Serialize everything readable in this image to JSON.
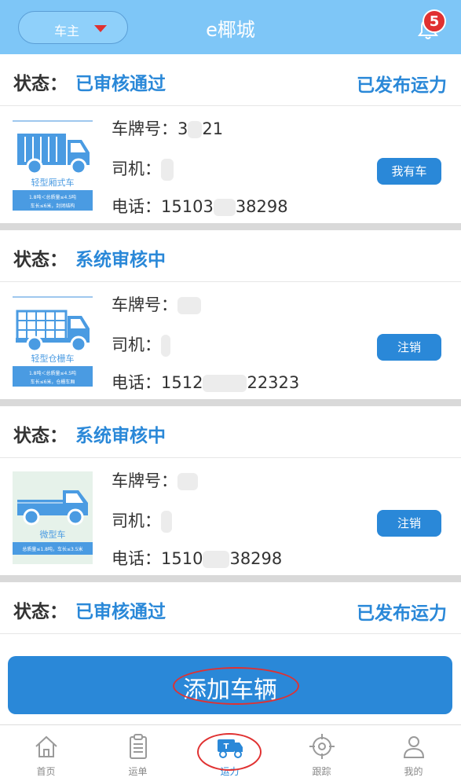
{
  "header": {
    "role": "车主",
    "title": "e椰城",
    "notification_count": "5"
  },
  "cards": [
    {
      "status_label": "状态：",
      "status": "已审核通过",
      "header_action": "已发布运力",
      "vehicle_type": "轻型厢式车",
      "vehicle_spec_1": "1.8吨＜总质量≤4.5吨",
      "vehicle_spec_2": "车长≤6米，封闭结构",
      "plate_label": "车牌号：",
      "plate_value": "3",
      "plate_suffix": "21",
      "driver_label": "司机：",
      "phone_label": "电话：",
      "phone_prefix": "15103",
      "phone_suffix": "38298",
      "button": "我有车"
    },
    {
      "status_label": "状态：",
      "status": "系统审核中",
      "vehicle_type": "轻型仓栅车",
      "vehicle_spec_1": "1.8吨＜总质量≤4.5吨",
      "vehicle_spec_2": "车长≤6米，仓栅车厢",
      "plate_label": "车牌号：",
      "driver_label": "司机：",
      "phone_label": "电话：",
      "phone_prefix": "1512",
      "phone_suffix": "22323",
      "button": "注销"
    },
    {
      "status_label": "状态：",
      "status": "系统审核中",
      "vehicle_type": "微型车",
      "vehicle_spec_1": "总质量≤1.8吨，车长≤3.5米",
      "plate_label": "车牌号：",
      "driver_label": "司机：",
      "phone_label": "电话：",
      "phone_prefix": "1510",
      "phone_suffix": "38298",
      "button": "注销"
    },
    {
      "status_label": "状态：",
      "status": "已审核通过",
      "header_action": "已发布运力"
    }
  ],
  "add_vehicle": "添加车辆",
  "tabs": [
    {
      "label": "首页",
      "icon": "home-icon"
    },
    {
      "label": "运单",
      "icon": "clipboard-icon"
    },
    {
      "label": "运力",
      "icon": "truck-icon"
    },
    {
      "label": "跟踪",
      "icon": "target-icon"
    },
    {
      "label": "我的",
      "icon": "user-icon"
    }
  ],
  "colors": {
    "header": "#7ec6f7",
    "accent": "#2a88d8",
    "badge": "#e03131",
    "annotation": "#e03131"
  }
}
